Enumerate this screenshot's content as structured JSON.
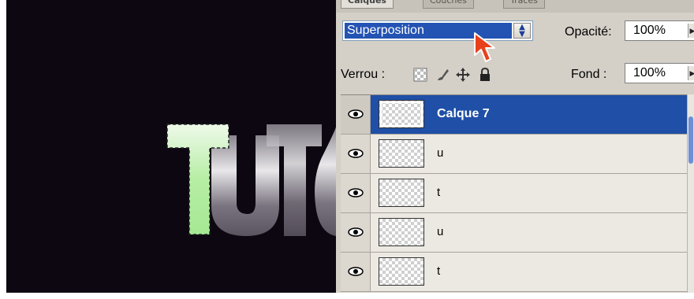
{
  "tabs": [
    "Calques",
    "Couches",
    "Tracés"
  ],
  "blend_mode": {
    "selected": "Superposition"
  },
  "opacity": {
    "label": "Opacité:",
    "value": "100%"
  },
  "lock": {
    "label": "Verrou :"
  },
  "fill": {
    "label": "Fond :",
    "value": "100%"
  },
  "layers": [
    {
      "name": "Calque 7",
      "selected": true
    },
    {
      "name": "u",
      "selected": false
    },
    {
      "name": "t",
      "selected": false
    },
    {
      "name": "u",
      "selected": false
    },
    {
      "name": "t",
      "selected": false
    }
  ],
  "canvas": {
    "background": "#0c0710",
    "selection_color": "#b8f2a6"
  }
}
